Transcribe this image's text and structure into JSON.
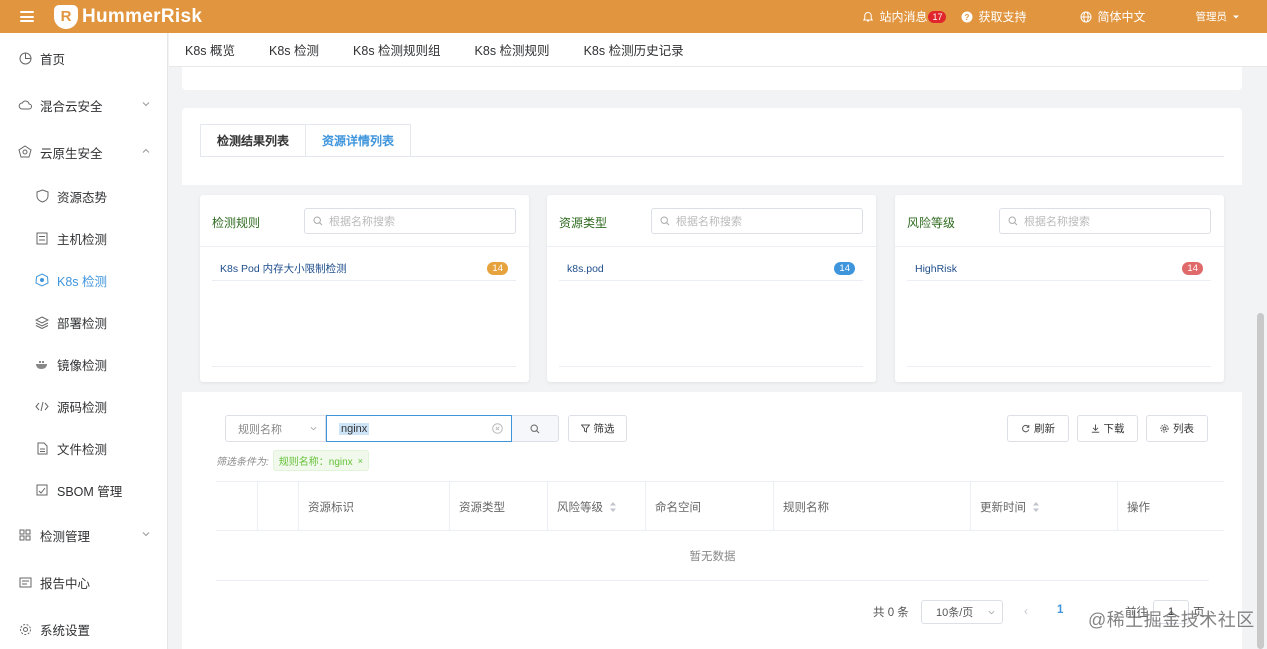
{
  "header": {
    "app_name": "HummerRisk",
    "messages_label": "站内消息",
    "messages_count": "17",
    "support_label": "获取支持",
    "language_label": "简体中文",
    "user_label": "管理员"
  },
  "sidebar": {
    "items": [
      {
        "label": "首页",
        "icon": "dashboard-icon"
      },
      {
        "label": "混合云安全",
        "icon": "cloud-icon"
      },
      {
        "label": "云原生安全",
        "icon": "cloud-native-icon"
      },
      {
        "label": "资源态势",
        "icon": "shield-icon"
      },
      {
        "label": "主机检测",
        "icon": "server-icon"
      },
      {
        "label": "K8s 检测",
        "icon": "kubernetes-icon"
      },
      {
        "label": "部署检测",
        "icon": "layers-icon"
      },
      {
        "label": "镜像检测",
        "icon": "docker-icon"
      },
      {
        "label": "源码检测",
        "icon": "code-icon"
      },
      {
        "label": "文件检测",
        "icon": "file-icon"
      },
      {
        "label": "SBOM 管理",
        "icon": "sbom-icon"
      },
      {
        "label": "检测管理",
        "icon": "grid-icon"
      },
      {
        "label": "报告中心",
        "icon": "report-icon"
      },
      {
        "label": "系统设置",
        "icon": "gear-icon"
      }
    ]
  },
  "nav_tabs": [
    "K8s 概览",
    "K8s 检测",
    "K8s 检测规则组",
    "K8s 检测规则",
    "K8s 检测历史记录"
  ],
  "sub_tabs": [
    "检测结果列表",
    "资源详情列表"
  ],
  "facets": [
    {
      "title": "检测规则",
      "placeholder": "根据名称搜索",
      "item": "K8s Pod 内存大小限制检测",
      "count": "14",
      "color": "#e6a23c"
    },
    {
      "title": "资源类型",
      "placeholder": "根据名称搜索",
      "item": "k8s.pod",
      "count": "14",
      "color": "#3f95dc"
    },
    {
      "title": "风险等级",
      "placeholder": "根据名称搜索",
      "item": "HighRisk",
      "count": "14",
      "color": "#e06a6a"
    }
  ],
  "toolbar": {
    "select_value": "规则名称",
    "search_value": "nginx",
    "filter_label": "筛选",
    "refresh_label": "刷新",
    "download_label": "下载",
    "columns_label": "列表",
    "condition_label": "筛选条件为:",
    "condition_tag": "规则名称：nginx"
  },
  "table": {
    "columns": [
      "资源标识",
      "资源类型",
      "风险等级",
      "命名空间",
      "规则名称",
      "更新时间",
      "操作"
    ],
    "empty_text": "暂无数据"
  },
  "pagination": {
    "total": "共 0 条",
    "page_size": "10条/页",
    "current": "1",
    "goto_label": "前往",
    "goto_value": "1",
    "page_suffix": "页"
  },
  "watermark": "@稀土掘金技术社区",
  "colors": {
    "header": "#e1953f",
    "accent": "#3f95dc"
  }
}
